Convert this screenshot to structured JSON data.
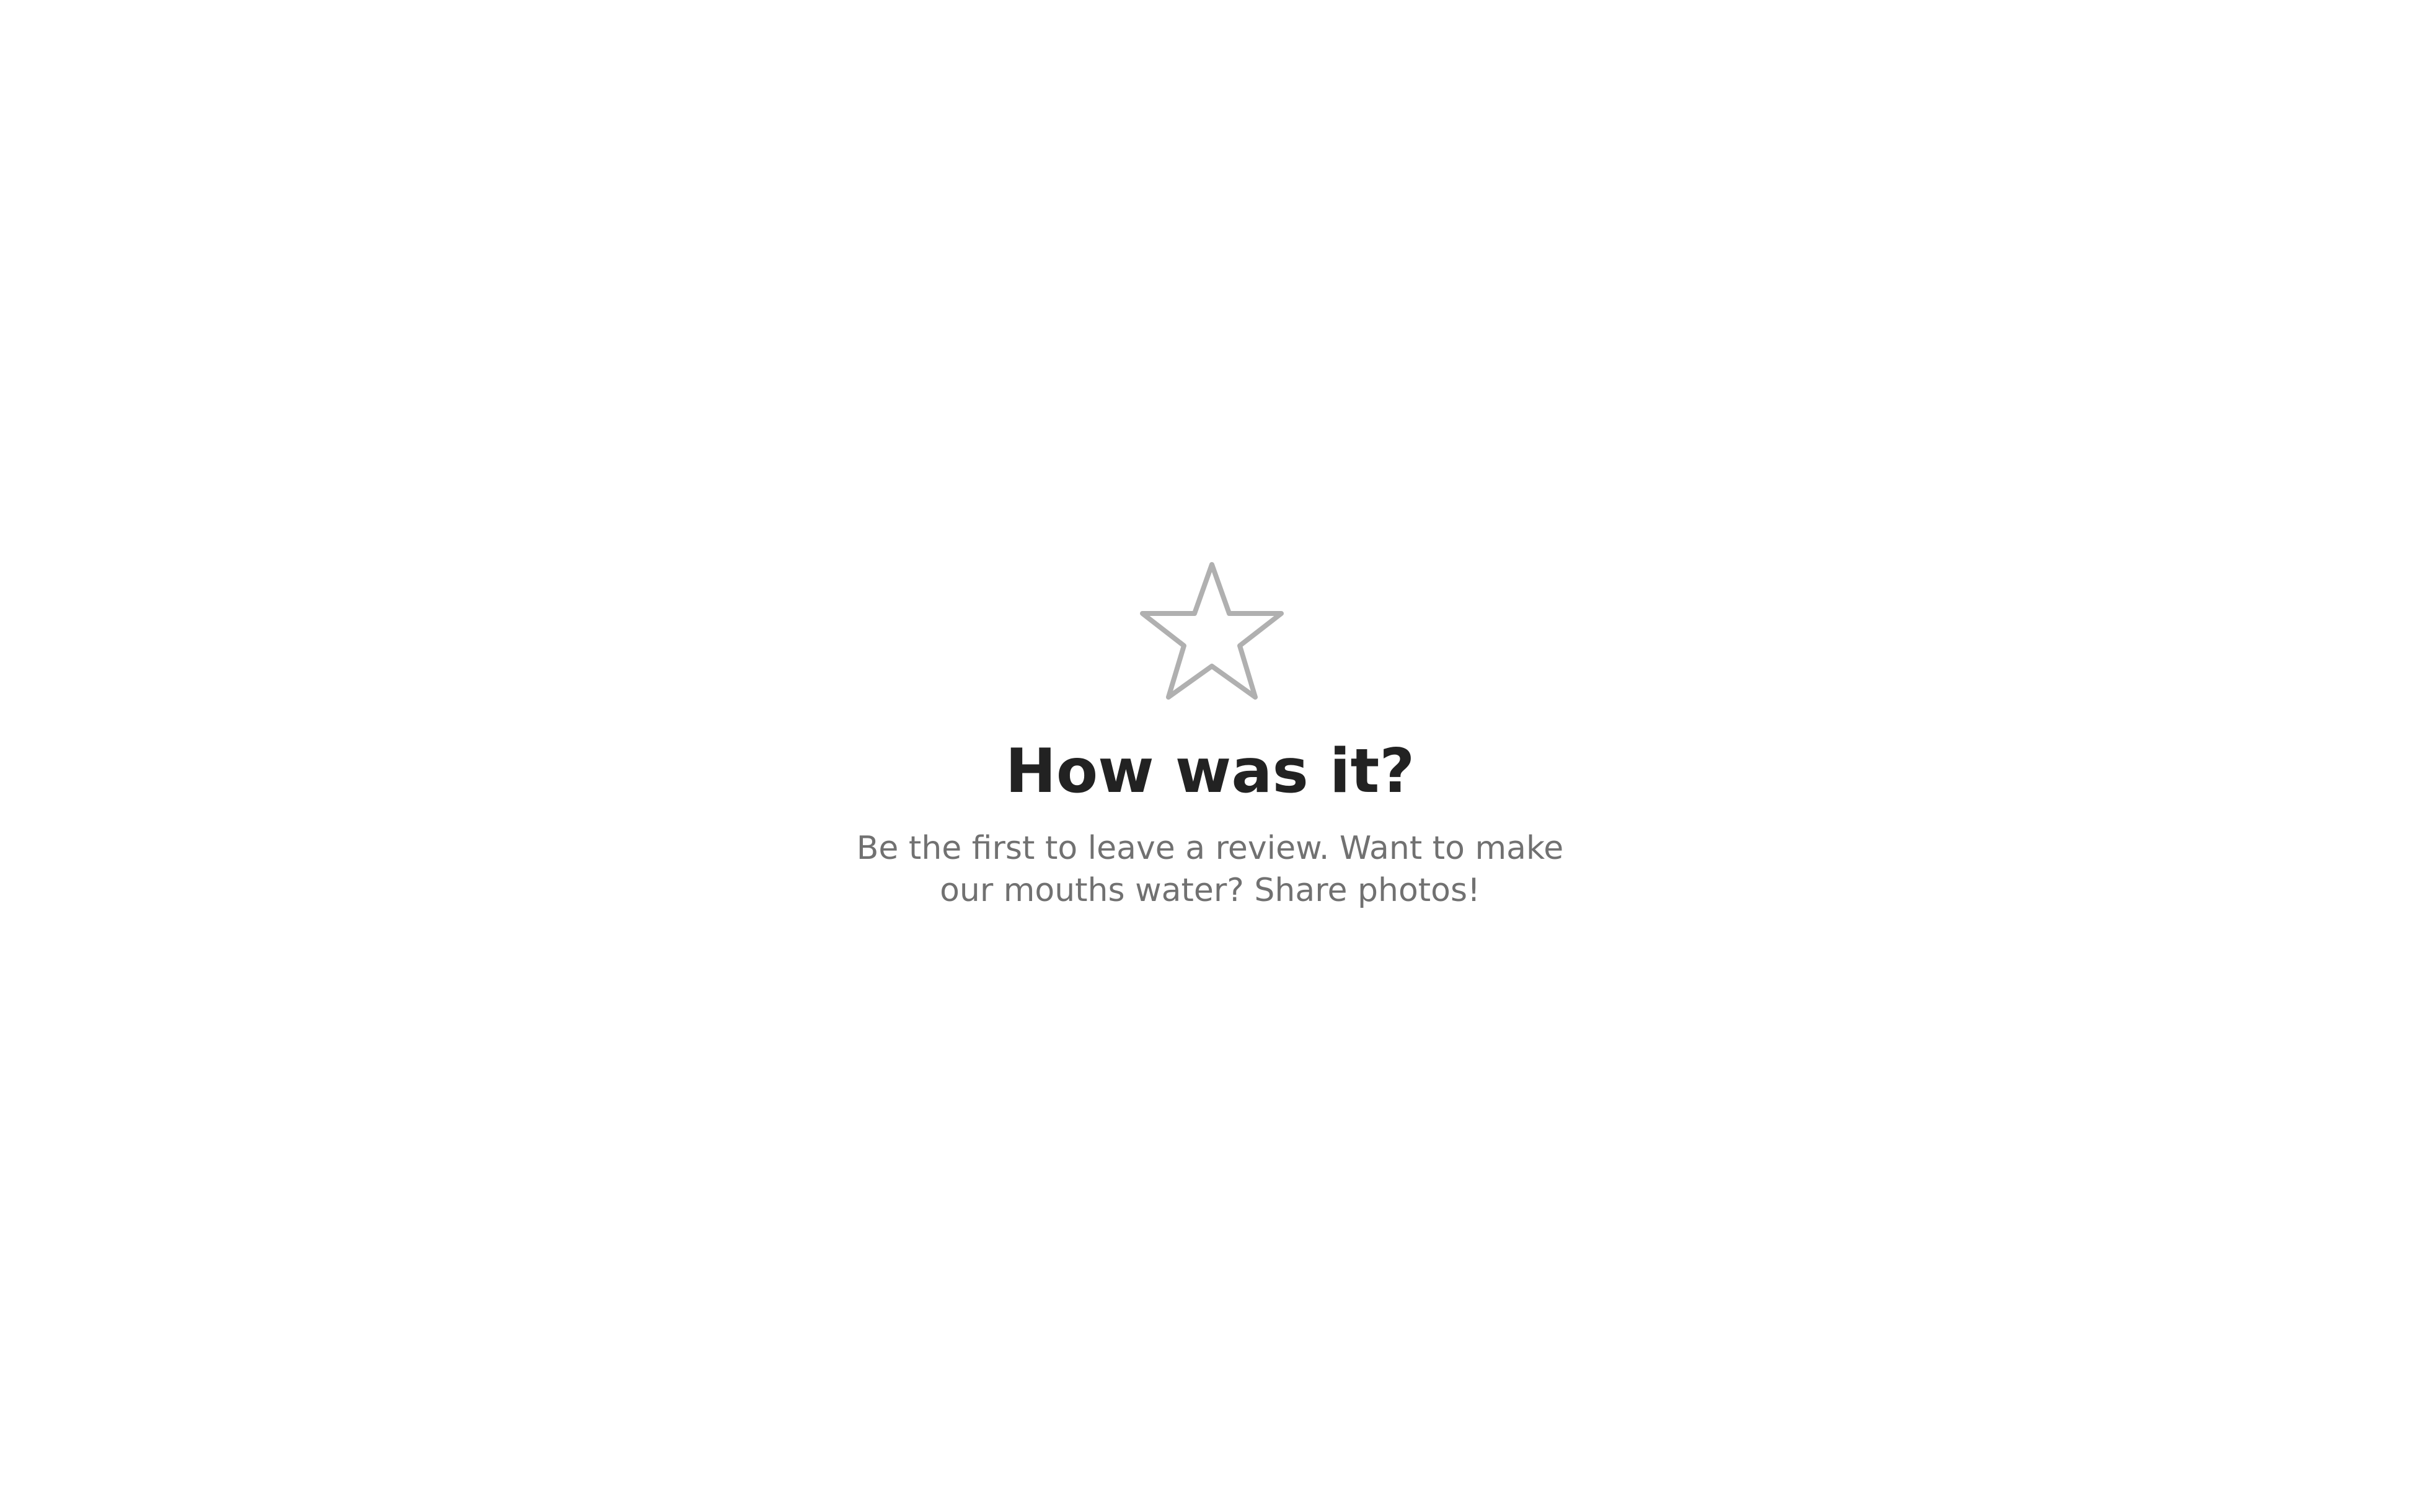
{
  "empty_state": {
    "icon": "star-outline-icon",
    "icon_color": "#b0b0b0",
    "title": "How was it?",
    "message": "Be the first to leave a review. Want to make our mouths water? Share photos!"
  },
  "colors": {
    "background": "#ffffff",
    "title": "#222222",
    "message": "#717171"
  }
}
